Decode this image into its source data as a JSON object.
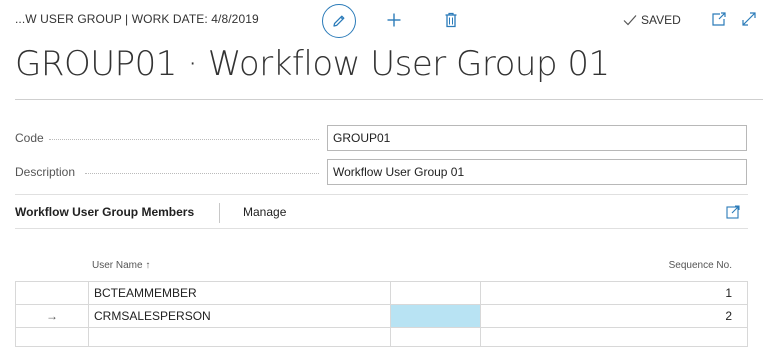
{
  "header": {
    "breadcrumb": "...W USER GROUP | WORK DATE: 4/8/2019",
    "saved_label": "SAVED",
    "icons": {
      "edit": "pencil-icon",
      "new": "plus-icon",
      "delete": "trash-icon",
      "saved": "checkmark-icon",
      "open_new_window": "open-in-new-window-icon",
      "expand": "expand-icon"
    }
  },
  "page": {
    "title": "GROUP01 · Workflow User Group 01"
  },
  "general": {
    "code_label": "Code",
    "code_value": "GROUP01",
    "description_label": "Description",
    "description_value": "Workflow User Group 01"
  },
  "members_part": {
    "title": "Workflow User Group Members",
    "manage_label": "Manage",
    "columns": {
      "user_name": "User Name ↑",
      "sequence_no": "Sequence No."
    },
    "rows": [
      {
        "indicator": "",
        "user_name": "BCTEAMMEMBER",
        "sequence_no": "1"
      },
      {
        "indicator": "→",
        "user_name": "CRMSALESPERSON",
        "sequence_no": "2"
      },
      {
        "indicator": "",
        "user_name": "",
        "sequence_no": ""
      }
    ]
  },
  "colors": {
    "accent": "#2b7bb9",
    "selected_cell": "#b8e3f3",
    "rule": "#cfcfcf"
  }
}
